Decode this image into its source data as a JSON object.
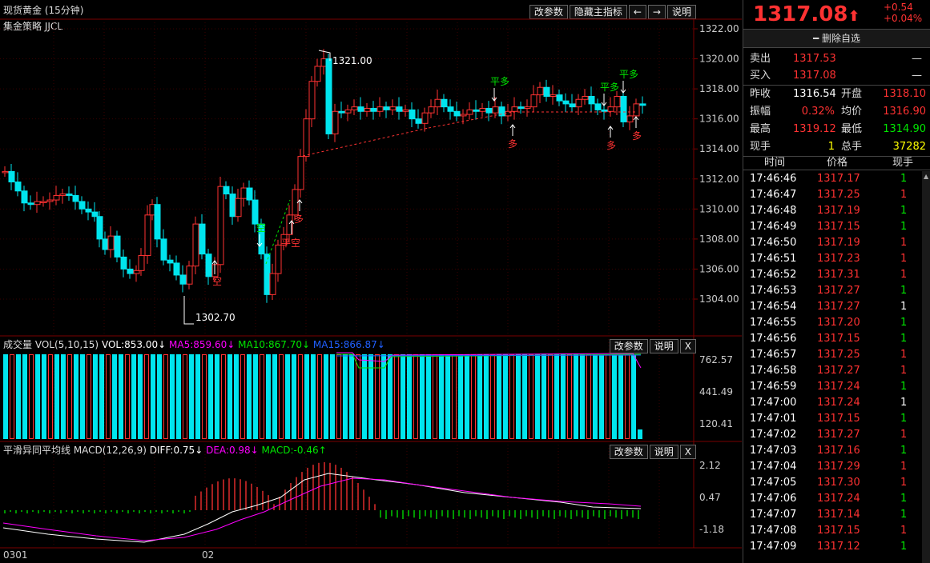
{
  "header": {
    "title": "现货黄金 (15分钟)",
    "strategy": "集金策略 JJCL",
    "buttons": [
      "改参数",
      "隐藏主指标",
      "←",
      "→",
      "说明"
    ]
  },
  "price_axis": [
    "1322.00",
    "1320.00",
    "1318.00",
    "1316.00",
    "1314.00",
    "1312.00",
    "1310.00",
    "1308.00",
    "1306.00",
    "1304.00"
  ],
  "annotations": {
    "high_label": "1321.00",
    "low_label": "1302.70",
    "signals": [
      {
        "text": "平多",
        "color": "#00e600"
      },
      {
        "text": "平多",
        "color": "#00e600"
      },
      {
        "text": "平多",
        "color": "#00e600"
      },
      {
        "text": "空",
        "color": "#00e600"
      },
      {
        "text": "空",
        "color": "#ff3232"
      },
      {
        "text": "平空",
        "color": "#ff3232"
      },
      {
        "text": "多",
        "color": "#ff3232"
      },
      {
        "text": "多",
        "color": "#ff3232"
      },
      {
        "text": "多",
        "color": "#ff3232"
      },
      {
        "text": "多",
        "color": "#ff3232"
      }
    ]
  },
  "volume_panel": {
    "label": "成交量 VOL(5,10,15)",
    "vol": "VOL:853.00↓",
    "ma5": "MA5:859.60↓",
    "ma10": "MA10:867.70↓",
    "ma15": "MA15:866.87↓",
    "axis": [
      "762.57",
      "441.49",
      "120.41"
    ],
    "buttons": [
      "改参数",
      "说明",
      "X"
    ]
  },
  "macd_panel": {
    "label": "平滑异同平均线 MACD(12,26,9)",
    "diff": "DIFF:0.75↓",
    "dea": "DEA:0.98↓",
    "macd": "MACD:-0.46↑",
    "axis": [
      "2.12",
      "0.47",
      "-1.18"
    ],
    "buttons": [
      "改参数",
      "说明",
      "X"
    ]
  },
  "time_axis": [
    "0301",
    "02"
  ],
  "quote": {
    "price": "1317.08",
    "arrow": "⬆",
    "change": "+0.54",
    "change_pct": "+0.04%",
    "remove_watch": "删除自选",
    "sell_label": "卖出",
    "sell_value": "1317.53",
    "sell_vol": "—",
    "buy_label": "买入",
    "buy_value": "1317.08",
    "buy_vol": "—",
    "prev_close_label": "昨收",
    "prev_close": "1316.54",
    "open_label": "开盘",
    "open": "1318.10",
    "amp_label": "振幅",
    "amp": "0.32%",
    "avg_label": "均价",
    "avg": "1316.90",
    "high_label": "最高",
    "high": "1319.12",
    "low_label": "最低",
    "low": "1314.90",
    "cur_vol_label": "现手",
    "cur_vol": "1",
    "total_vol_label": "总手",
    "total_vol": "37282"
  },
  "ticks": {
    "headers": [
      "时间",
      "价格",
      "现手"
    ],
    "rows": [
      {
        "time": "17:46:46",
        "price": "1317.17",
        "vol": "1",
        "vc": "green"
      },
      {
        "time": "17:46:47",
        "price": "1317.25",
        "vol": "1",
        "vc": "red"
      },
      {
        "time": "17:46:48",
        "price": "1317.19",
        "vol": "1",
        "vc": "green"
      },
      {
        "time": "17:46:49",
        "price": "1317.15",
        "vol": "1",
        "vc": "green"
      },
      {
        "time": "17:46:50",
        "price": "1317.19",
        "vol": "1",
        "vc": "red"
      },
      {
        "time": "17:46:51",
        "price": "1317.23",
        "vol": "1",
        "vc": "red"
      },
      {
        "time": "17:46:52",
        "price": "1317.31",
        "vol": "1",
        "vc": "red"
      },
      {
        "time": "17:46:53",
        "price": "1317.27",
        "vol": "1",
        "vc": "green"
      },
      {
        "time": "17:46:54",
        "price": "1317.27",
        "vol": "1",
        "vc": "white"
      },
      {
        "time": "17:46:55",
        "price": "1317.20",
        "vol": "1",
        "vc": "green"
      },
      {
        "time": "17:46:56",
        "price": "1317.15",
        "vol": "1",
        "vc": "green"
      },
      {
        "time": "17:46:57",
        "price": "1317.25",
        "vol": "1",
        "vc": "red"
      },
      {
        "time": "17:46:58",
        "price": "1317.27",
        "vol": "1",
        "vc": "red"
      },
      {
        "time": "17:46:59",
        "price": "1317.24",
        "vol": "1",
        "vc": "green"
      },
      {
        "time": "17:47:00",
        "price": "1317.24",
        "vol": "1",
        "vc": "white"
      },
      {
        "time": "17:47:01",
        "price": "1317.15",
        "vol": "1",
        "vc": "green"
      },
      {
        "time": "17:47:02",
        "price": "1317.27",
        "vol": "1",
        "vc": "red"
      },
      {
        "time": "17:47:03",
        "price": "1317.16",
        "vol": "1",
        "vc": "green"
      },
      {
        "time": "17:47:04",
        "price": "1317.29",
        "vol": "1",
        "vc": "red"
      },
      {
        "time": "17:47:05",
        "price": "1317.30",
        "vol": "1",
        "vc": "red"
      },
      {
        "time": "17:47:06",
        "price": "1317.24",
        "vol": "1",
        "vc": "green"
      },
      {
        "time": "17:47:07",
        "price": "1317.14",
        "vol": "1",
        "vc": "green"
      },
      {
        "time": "17:47:08",
        "price": "1317.15",
        "vol": "1",
        "vc": "red"
      },
      {
        "time": "17:47:09",
        "price": "1317.12",
        "vol": "1",
        "vc": "green"
      }
    ]
  },
  "colors": {
    "up": "#ff3232",
    "down": "#00e5ee",
    "grid": "#7a0000",
    "ma5": "#ff00ff",
    "ma10": "#00e600",
    "ma15": "#2060ff",
    "diff": "#ffffff",
    "dea": "#ff00ff"
  }
}
